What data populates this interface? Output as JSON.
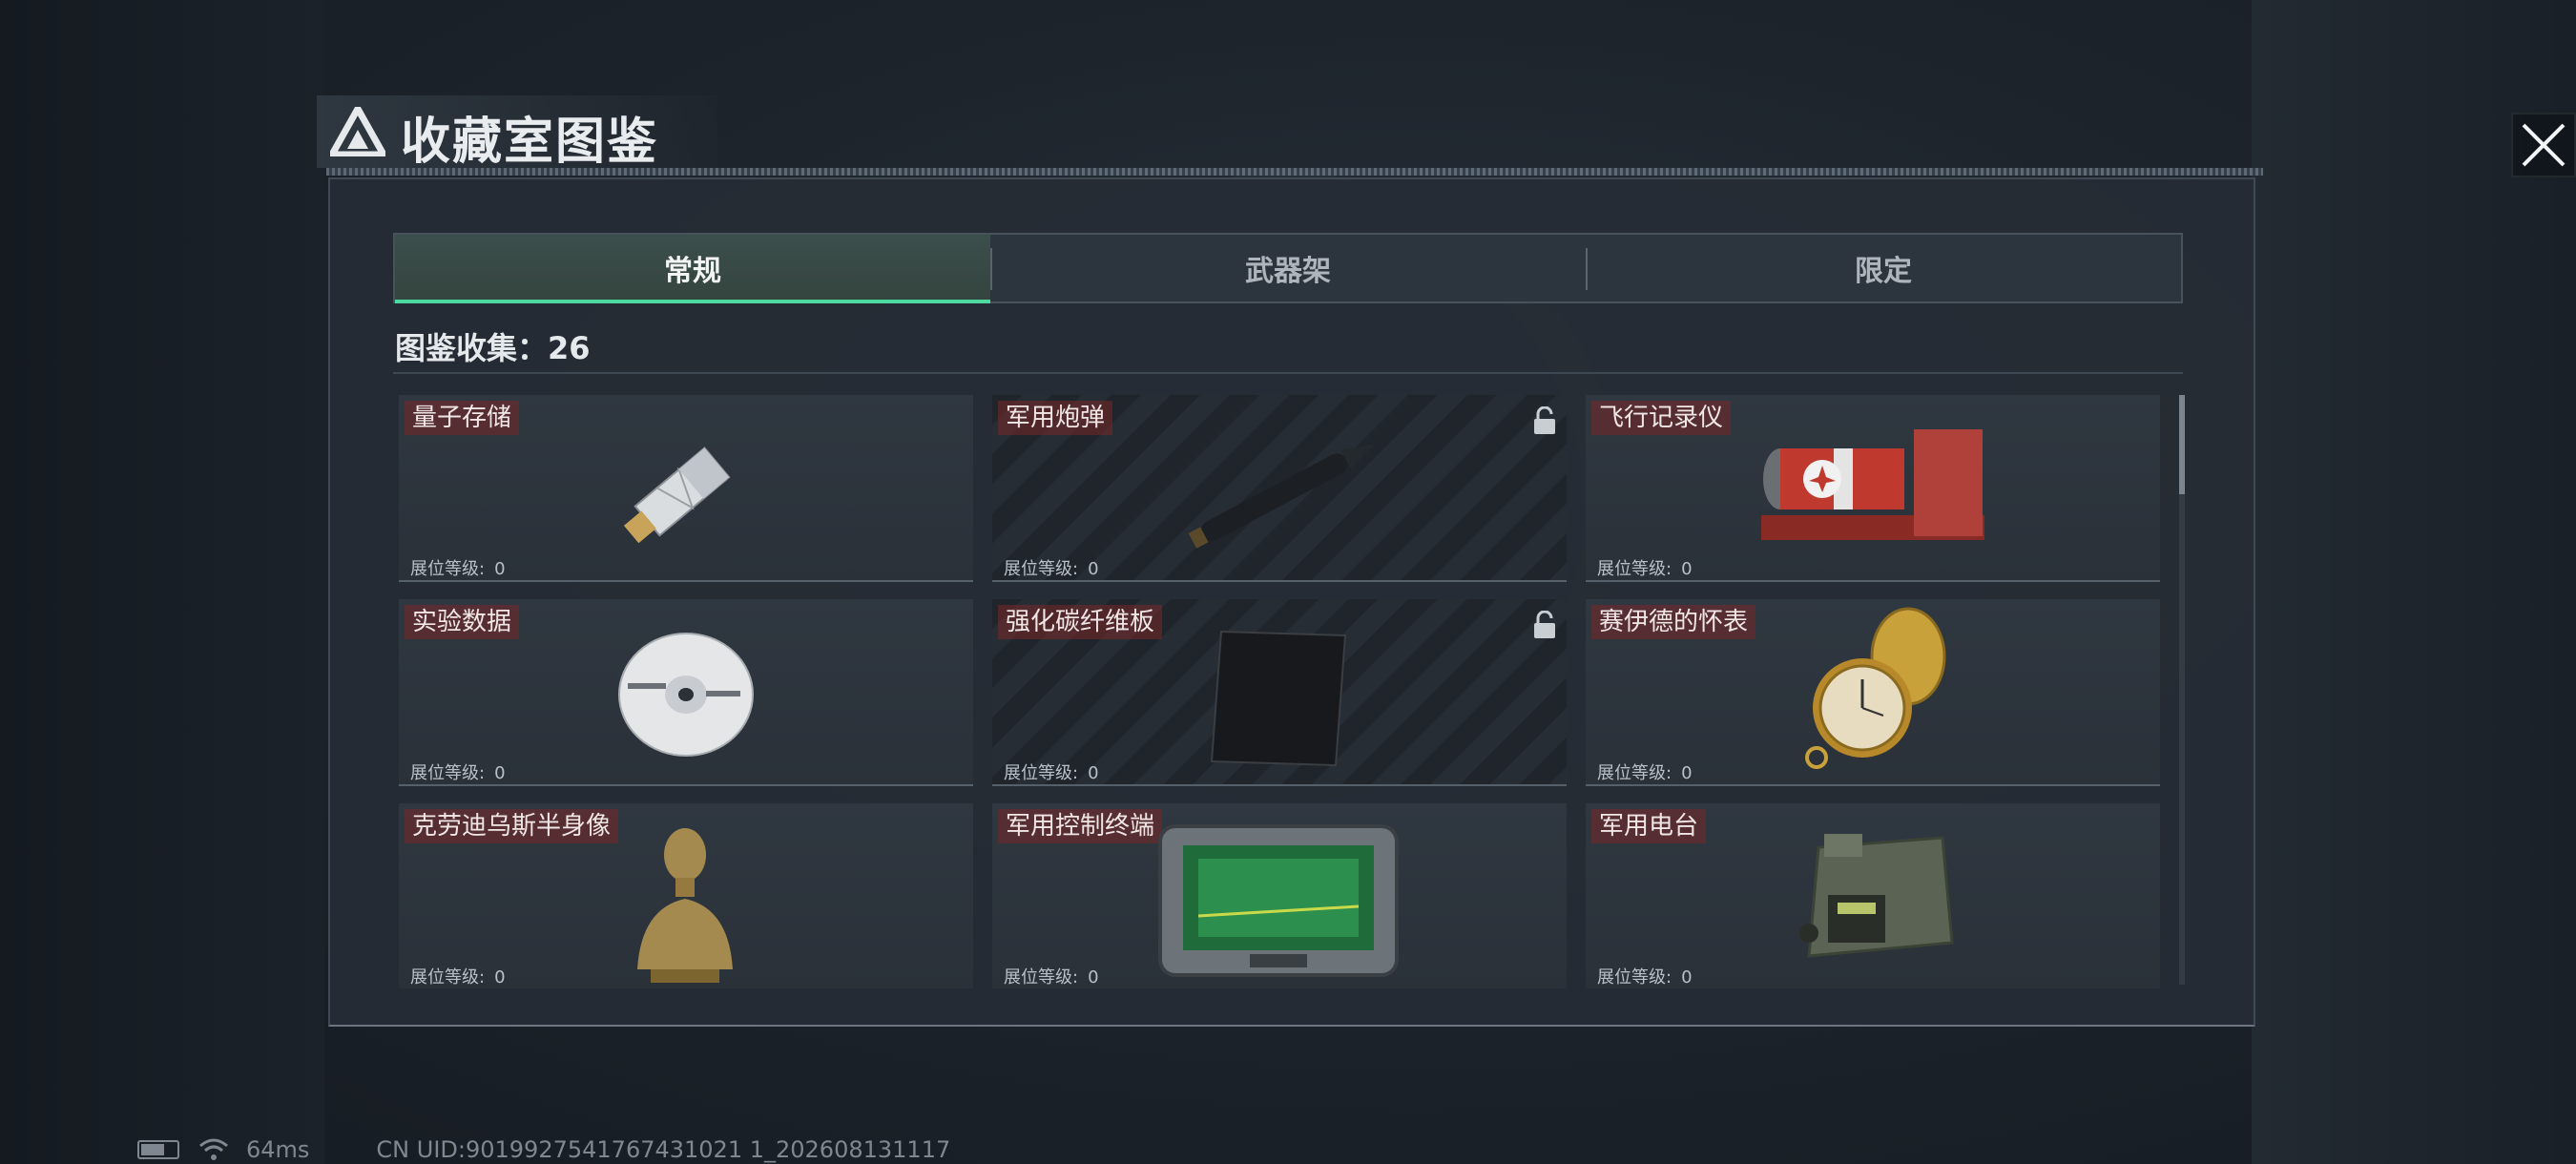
{
  "header": {
    "title": "收藏室图鉴"
  },
  "tabs": [
    {
      "label": "常规",
      "active": true
    },
    {
      "label": "武器架",
      "active": false
    },
    {
      "label": "限定",
      "active": false
    }
  ],
  "collection": {
    "label": "图鉴收集：26"
  },
  "cards": [
    {
      "name": "量子存储",
      "level_label": "展位等级:",
      "level": "0",
      "locked": false,
      "icon": "usb-drive-icon"
    },
    {
      "name": "军用炮弹",
      "level_label": "展位等级:",
      "level": "0",
      "locked": true,
      "icon": "artillery-shell-icon"
    },
    {
      "name": "飞行记录仪",
      "level_label": "展位等级:",
      "level": "0",
      "locked": false,
      "icon": "flight-recorder-icon"
    },
    {
      "name": "实验数据",
      "level_label": "展位等级:",
      "level": "0",
      "locked": false,
      "icon": "disc-icon"
    },
    {
      "name": "强化碳纤维板",
      "level_label": "展位等级:",
      "level": "0",
      "locked": true,
      "icon": "carbon-plate-icon"
    },
    {
      "name": "赛伊德的怀表",
      "level_label": "展位等级:",
      "level": "0",
      "locked": false,
      "icon": "pocket-watch-icon"
    },
    {
      "name": "克劳迪乌斯半身像",
      "level_label": "展位等级:",
      "level": "0",
      "locked": false,
      "icon": "bust-icon"
    },
    {
      "name": "军用控制终端",
      "level_label": "展位等级:",
      "level": "0",
      "locked": false,
      "icon": "control-terminal-icon"
    },
    {
      "name": "军用电台",
      "level_label": "展位等级:",
      "level": "0",
      "locked": false,
      "icon": "radio-icon"
    }
  ],
  "status": {
    "ping": "64ms",
    "uid": "CN UID:9019927541767431021 1_202608131117"
  },
  "colors": {
    "accent": "#4dd9a0",
    "label_bg": "#782828"
  }
}
